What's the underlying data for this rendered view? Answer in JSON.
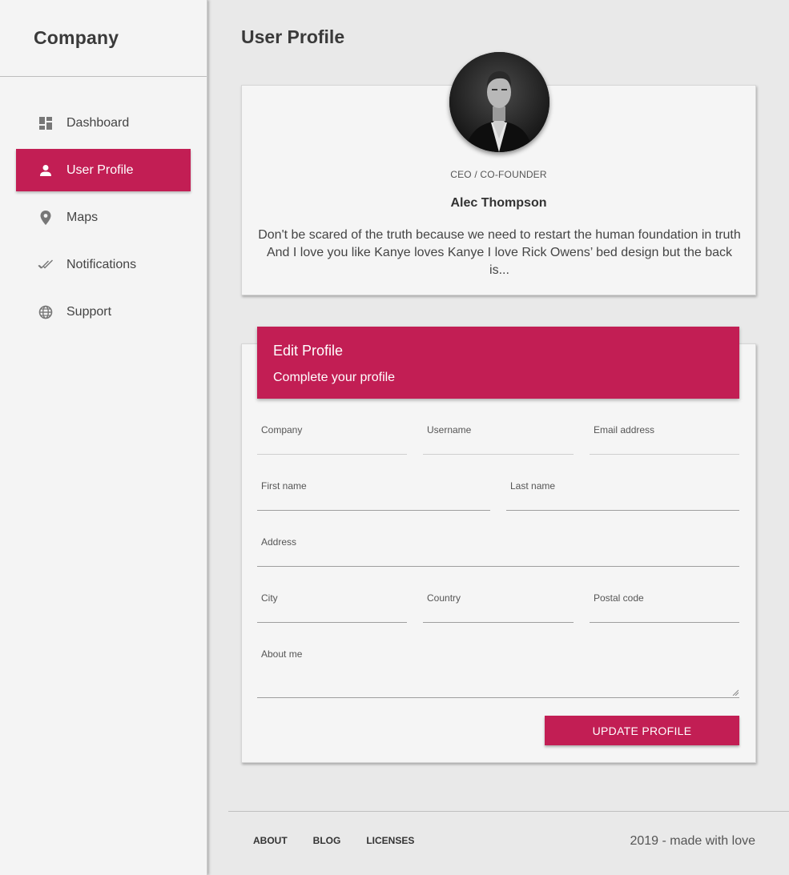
{
  "brand": {
    "name": "Company"
  },
  "sidebar": {
    "items": [
      {
        "label": "Dashboard",
        "icon": "dashboard-icon"
      },
      {
        "label": "User Profile",
        "icon": "person-icon",
        "active": true
      },
      {
        "label": "Maps",
        "icon": "location-pin-icon"
      },
      {
        "label": "Notifications",
        "icon": "done-all-icon"
      },
      {
        "label": "Support",
        "icon": "globe-icon"
      }
    ]
  },
  "page": {
    "title": "User Profile"
  },
  "profile": {
    "role": "CEO / CO-FOUNDER",
    "name": "Alec Thompson",
    "bio": "Don't be scared of the truth because we need to restart the human foundation in truth And I love you like Kanye loves Kanye I love Rick Owens’ bed design but the back is..."
  },
  "edit_profile": {
    "title": "Edit Profile",
    "subtitle": "Complete your profile",
    "fields": {
      "company": {
        "label": "Company",
        "value": ""
      },
      "username": {
        "label": "Username",
        "value": ""
      },
      "email": {
        "label": "Email address",
        "value": ""
      },
      "first_name": {
        "label": "First name",
        "value": ""
      },
      "last_name": {
        "label": "Last name",
        "value": ""
      },
      "address": {
        "label": "Address",
        "value": ""
      },
      "city": {
        "label": "City",
        "value": ""
      },
      "country": {
        "label": "Country",
        "value": ""
      },
      "postal_code": {
        "label": "Postal code",
        "value": ""
      },
      "about_me": {
        "label": "About me",
        "value": ""
      }
    },
    "submit_label": "UPDATE PROFILE"
  },
  "footer": {
    "links": [
      "ABOUT",
      "BLOG",
      "LICENSES"
    ],
    "copyright": "2019 - made with love"
  },
  "colors": {
    "accent": "#c21e54",
    "background": "#e9e9e9",
    "card": "#f5f5f5"
  }
}
